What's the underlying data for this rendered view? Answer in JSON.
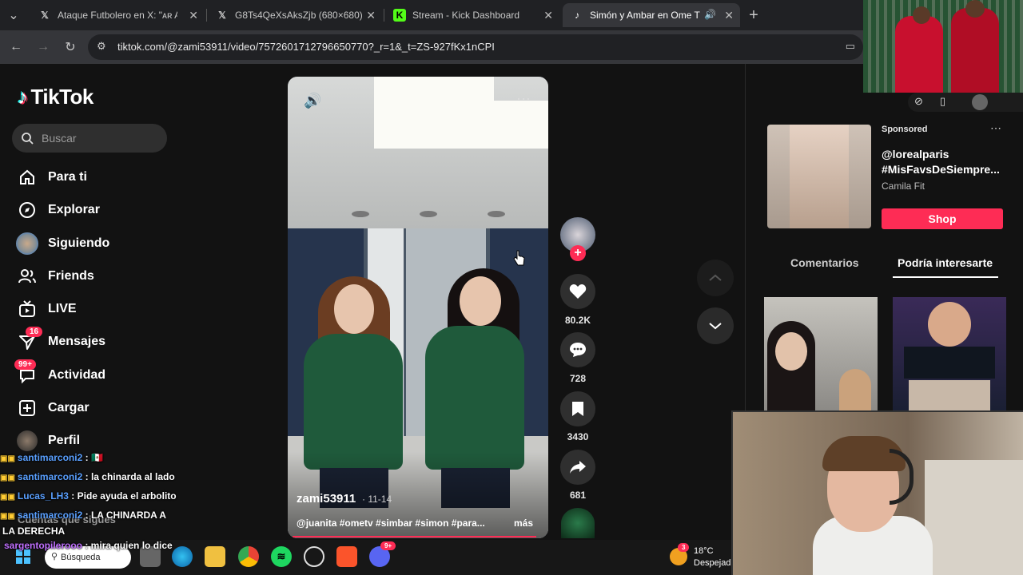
{
  "browser": {
    "tabs": [
      {
        "icon": "x-logo-icon",
        "title": "Ataque Futbolero en X: \"ᴀʀ Así\"",
        "active": false
      },
      {
        "icon": "x-logo-icon",
        "title": "G8Ts4QeXsAksZjb (680×680)",
        "active": false
      },
      {
        "icon": "kick-logo-icon",
        "title": "Stream - Kick Dashboard",
        "active": false
      },
      {
        "icon": "tiktok-logo-icon",
        "title": "Simón y Ambar en Ome TV",
        "active": true
      }
    ],
    "url": "tiktok.com/@zami53911/video/7572601712796650770?_r=1&_t=ZS-927fKx1nCPI"
  },
  "sidebar": {
    "logo": "TikTok",
    "search_placeholder": "Buscar",
    "items": [
      {
        "label": "Para ti",
        "icon": "home-icon"
      },
      {
        "label": "Explorar",
        "icon": "compass-icon"
      },
      {
        "label": "Siguiendo",
        "icon": "avatar-icon"
      },
      {
        "label": "Friends",
        "icon": "friends-icon"
      },
      {
        "label": "LIVE",
        "icon": "live-icon"
      },
      {
        "label": "Mensajes",
        "icon": "messages-icon",
        "badge": "16"
      },
      {
        "label": "Actividad",
        "icon": "activity-icon",
        "badge": "99+"
      },
      {
        "label": "Cargar",
        "icon": "upload-icon"
      },
      {
        "label": "Perfil",
        "icon": "profile-avatar-icon"
      }
    ],
    "following_section": "Cuentas que sigues"
  },
  "video": {
    "username": "zami53911",
    "date": "· 11-14",
    "caption": "@juanita #ometv #simbar #simon #para...",
    "more": "más",
    "progress": 0.97
  },
  "actions": {
    "likes": "80.2K",
    "comments": "728",
    "saves": "3430",
    "shares": "681"
  },
  "right_panel": {
    "ad": {
      "sponsored": "Sponsored",
      "title": "@lorealparis #MisFavsDeSiempre...",
      "subtitle": "Camila Fit",
      "cta": "Shop"
    },
    "tabs": [
      "Comentarios",
      "Podría interesarte"
    ],
    "active_tab": "Podría interesarte"
  },
  "chat": [
    {
      "user": "santimarconi2",
      "msg": " : 🇲🇽"
    },
    {
      "user": "santimarconi2",
      "msg": " : la chinarda al lado"
    },
    {
      "user": "Lucas_LH3",
      "msg": " : Pide ayuda el arbolito"
    },
    {
      "user": "santimarconi2",
      "msg": " : LA CHINARDA A"
    },
    {
      "user": "",
      "msg": "LA DERECHA"
    },
    {
      "user": "sargentopilerooo",
      "msg": " : mira quien lo dice"
    }
  ],
  "taskbar": {
    "search": "Búsqueda",
    "weather_temp": "18°C",
    "weather_desc": "Despejad",
    "weather_badge": "3",
    "discord_badge": "9+"
  },
  "colors": {
    "accent": "#fe2c55",
    "background": "#121212"
  }
}
